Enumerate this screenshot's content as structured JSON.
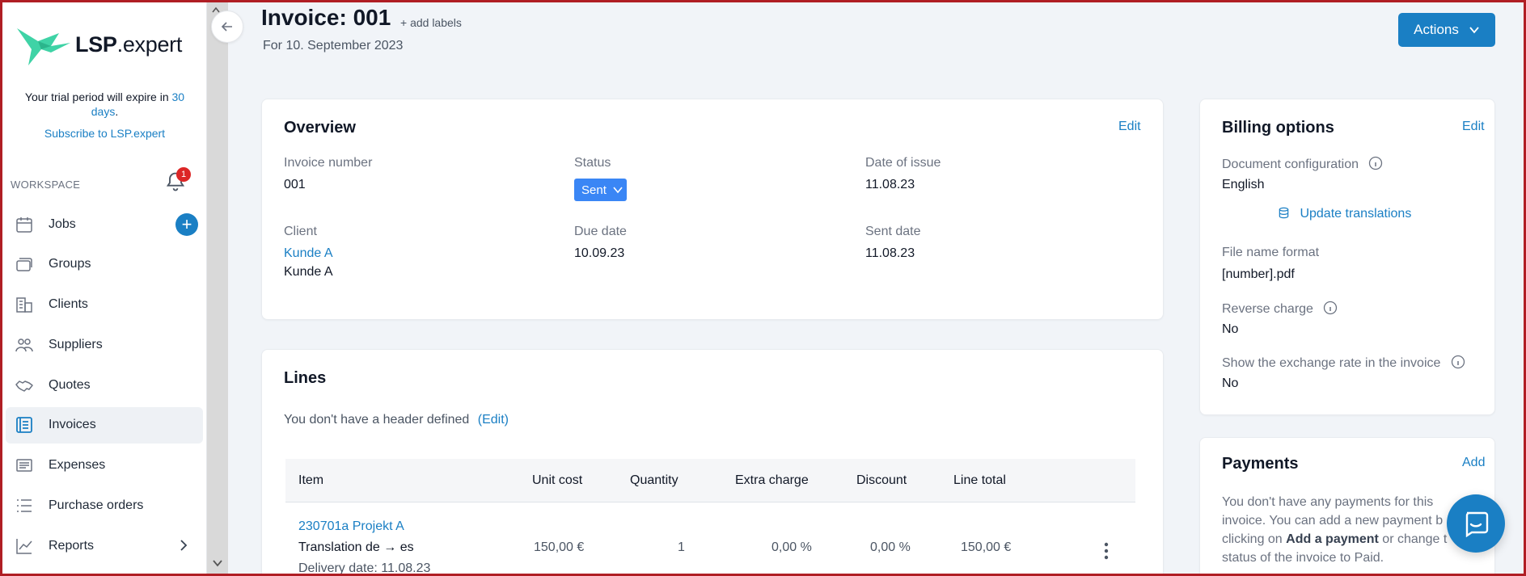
{
  "brand": {
    "name_bold": "LSP",
    "name_rest": ".expert",
    "color": "#3fd3a6"
  },
  "trial": {
    "text_before": "Your trial period will expire in ",
    "days_link": "30 days",
    "text_after": ".",
    "subscribe_link": "Subscribe to LSP.expert"
  },
  "sidebar": {
    "workspace_label": "WORKSPACE",
    "notification_count": "1",
    "items": [
      {
        "label": "Jobs",
        "icon": "calendar-icon"
      },
      {
        "label": "Groups",
        "icon": "stack-icon"
      },
      {
        "label": "Clients",
        "icon": "building-icon"
      },
      {
        "label": "Suppliers",
        "icon": "people-icon"
      },
      {
        "label": "Quotes",
        "icon": "handshake-icon"
      },
      {
        "label": "Invoices",
        "icon": "invoice-icon",
        "active": true
      },
      {
        "label": "Expenses",
        "icon": "receipt-icon"
      },
      {
        "label": "Purchase orders",
        "icon": "list-icon"
      },
      {
        "label": "Reports",
        "icon": "chart-icon"
      }
    ],
    "jobs_add": "+"
  },
  "header": {
    "title": "Invoice: 001",
    "add_labels": "+ add labels",
    "subtitle": "For 10. September 2023",
    "actions_label": "Actions"
  },
  "overview": {
    "title": "Overview",
    "edit": "Edit",
    "invoice_number_label": "Invoice number",
    "invoice_number": "001",
    "status_label": "Status",
    "status": "Sent",
    "date_of_issue_label": "Date of issue",
    "date_of_issue": "11.08.23",
    "client_label": "Client",
    "client_link": "Kunde A",
    "client_name": "Kunde A",
    "due_date_label": "Due date",
    "due_date": "10.09.23",
    "sent_date_label": "Sent date",
    "sent_date": "11.08.23"
  },
  "lines": {
    "title": "Lines",
    "header_notice": "You don't have a header defined",
    "header_edit": "(Edit)",
    "columns": [
      "Item",
      "Unit cost",
      "Quantity",
      "Extra charge",
      "Discount",
      "Line total"
    ],
    "rows": [
      {
        "item_link": "230701a Projekt A",
        "description": "Translation de → es",
        "delivery": "Delivery date: 11.08.23",
        "unit_cost": "150,00 €",
        "quantity": "1",
        "extra_charge": "0,00 %",
        "discount": "0,00 %",
        "line_total": "150,00 €"
      }
    ]
  },
  "billing": {
    "title": "Billing options",
    "edit": "Edit",
    "doc_config_label": "Document configuration",
    "doc_config": "English",
    "update_translations": "Update translations",
    "file_name_label": "File name format",
    "file_name": "[number].pdf",
    "reverse_charge_label": "Reverse charge",
    "reverse_charge": "No",
    "exchange_rate_label": "Show the exchange rate in the invoice",
    "exchange_rate": "No"
  },
  "payments": {
    "title": "Payments",
    "add": "Add",
    "text_1": "You don't have any payments for this",
    "text_2": "invoice. You can add a new payment b",
    "text_3a": "clicking on ",
    "text_3b": "Add a payment",
    "text_3c": " or change t",
    "text_4": "status of the invoice to Paid."
  },
  "colors": {
    "accent": "#1a7fc4",
    "status_pill": "#3a86f5",
    "badge": "#dc2626"
  }
}
